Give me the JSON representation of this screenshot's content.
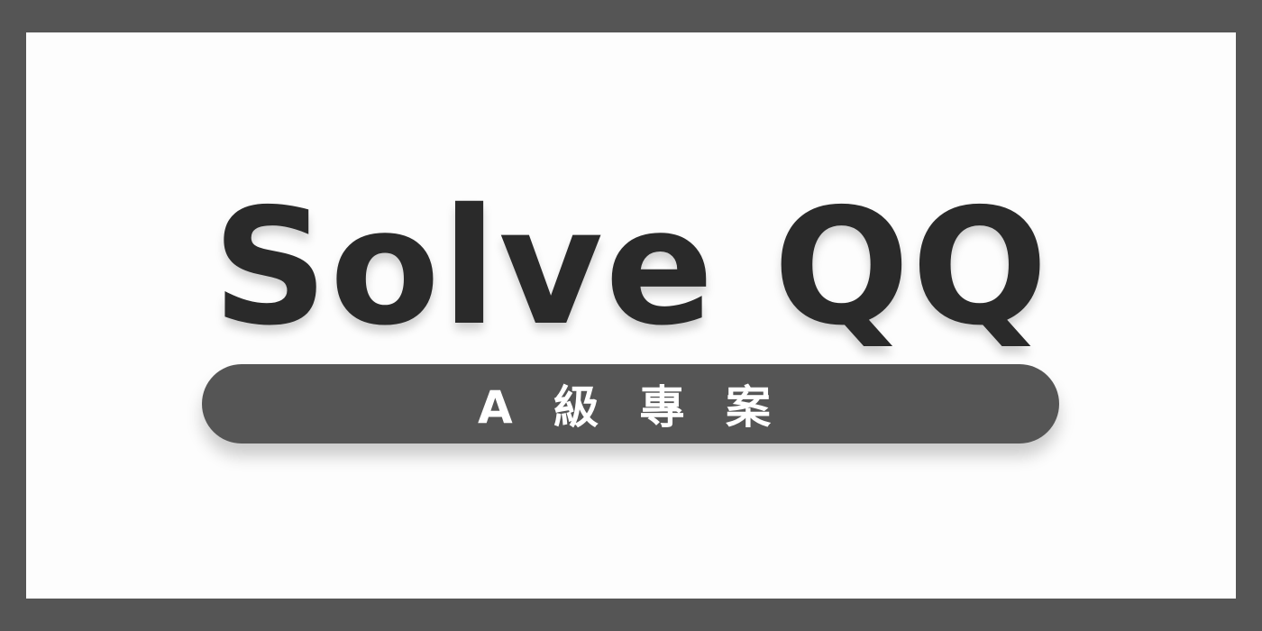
{
  "title": "Solve QQ",
  "badge": "A 級 專 案",
  "colors": {
    "frame": "#555555",
    "card": "#fdfdfd",
    "text": "#2a2a2a"
  }
}
